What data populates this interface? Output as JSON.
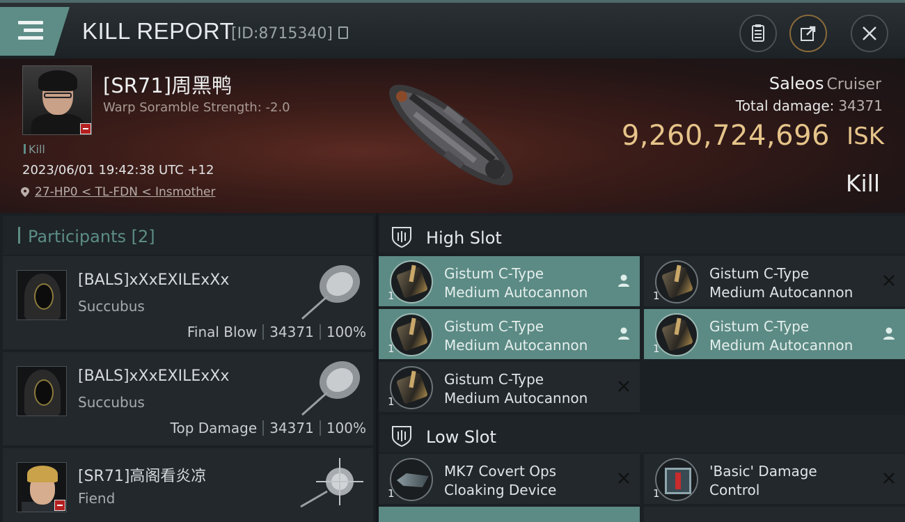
{
  "header": {
    "title": "KILL REPORT",
    "kill_id": "[ID:8715340]"
  },
  "victim": {
    "name": "[SR71]周黑鸭",
    "subtitle": "Warp Soramble Strength: -2.0",
    "tag": "Kill",
    "timestamp": "2023/06/01 19:42:38 UTC +12",
    "location": "27-HP0 < TL-FDN < Insmother",
    "ship_name": "Saleos",
    "ship_class": "Cruiser",
    "total_damage_label": "Total damage:",
    "total_damage_value": "34371",
    "isk_value": "9,260,724,696",
    "isk_unit": "ISK",
    "result_label": "Kill"
  },
  "participants": {
    "title": "Participants [2]",
    "rows": [
      {
        "name": "[BALS]xXxEXILExXx",
        "ship": "Succubus",
        "role": "Final Blow",
        "damage": "34371",
        "percent": "100%"
      },
      {
        "name": "[BALS]xXxEXILExXx",
        "ship": "Succubus",
        "role": "Top Damage",
        "damage": "34371",
        "percent": "100%"
      },
      {
        "name": "[SR71]高阁看炎凉",
        "ship": "Fiend"
      }
    ]
  },
  "fitting": {
    "high_slot": {
      "label": "High Slot",
      "modules": [
        {
          "line1": "Gistum C-Type",
          "line2": "Medium Autocannon",
          "qty": "1",
          "state": "fitted"
        },
        {
          "line1": "Gistum C-Type",
          "line2": "Medium Autocannon",
          "qty": "1",
          "state": "destroyed"
        },
        {
          "line1": "Gistum C-Type",
          "line2": "Medium Autocannon",
          "qty": "1",
          "state": "fitted"
        },
        {
          "line1": "Gistum C-Type",
          "line2": "Medium Autocannon",
          "qty": "1",
          "state": "fitted"
        },
        {
          "line1": "Gistum C-Type",
          "line2": "Medium Autocannon",
          "qty": "1",
          "state": "destroyed"
        }
      ]
    },
    "low_slot": {
      "label": "Low Slot",
      "modules": [
        {
          "line1": "MK7 Covert Ops",
          "line2": "Cloaking Device",
          "qty": "1",
          "state": "destroyed"
        },
        {
          "line1": "'Basic' Damage",
          "line2": "Control",
          "qty": "1",
          "state": "destroyed"
        }
      ]
    }
  },
  "colors": {
    "accent": "#5d8d86",
    "isk": "#e6c48a",
    "fitted_bg": "#5c8a84"
  },
  "icons": [
    "menu-icon",
    "copy-icon",
    "clipboard-icon",
    "share-icon",
    "close-icon",
    "location-pin-icon",
    "shield-slot-icon",
    "pilot-icon",
    "destroyed-x-icon"
  ]
}
